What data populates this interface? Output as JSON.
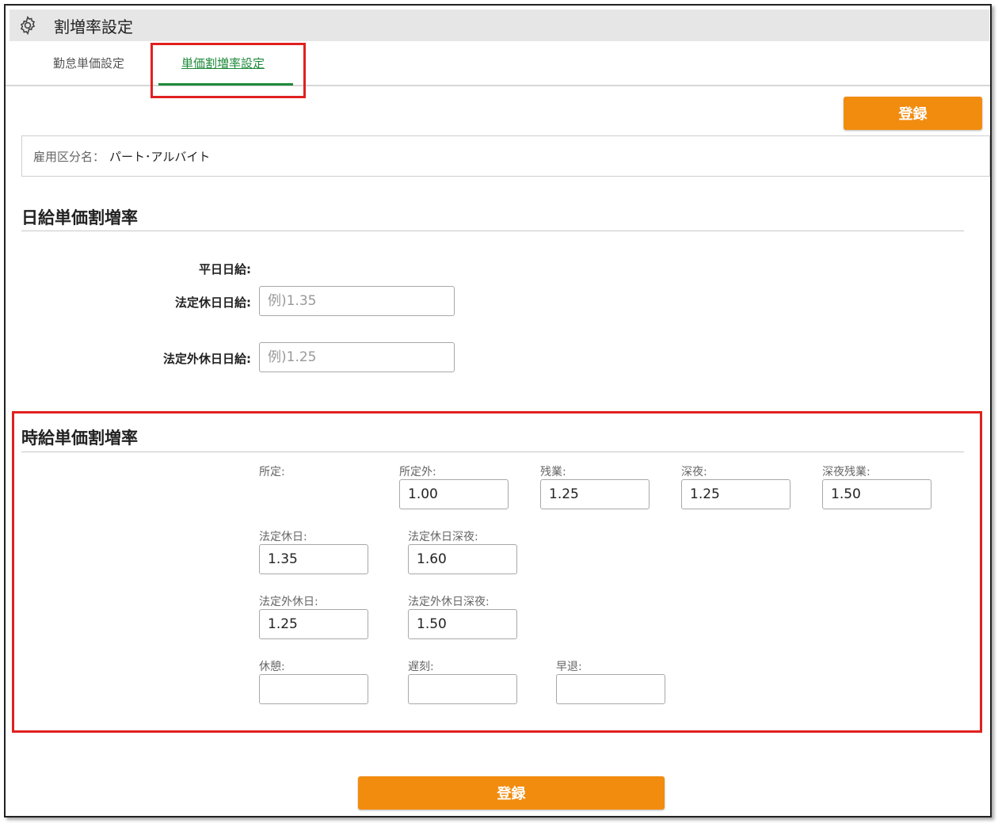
{
  "page_title": "割増率設定",
  "tabs": [
    {
      "label": "勤怠単価設定",
      "active": false
    },
    {
      "label": "単価割増率設定",
      "active": true
    }
  ],
  "register_label": "登録",
  "employment": {
    "label": "雇用区分名：",
    "value": "パート･アルバイト"
  },
  "daily": {
    "heading": "日給単価割増率",
    "weekday_label": "平日日給:",
    "legal_holiday_label": "法定休日日給:",
    "legal_holiday_placeholder": "例)1.35",
    "nonlegal_holiday_label": "法定外休日日給:",
    "nonlegal_holiday_placeholder": "例)1.25"
  },
  "hourly": {
    "heading": "時給単価割増率",
    "fields": {
      "scheduled": {
        "label": "所定:",
        "value": ""
      },
      "out_of_schedule": {
        "label": "所定外:",
        "value": "1.00"
      },
      "overtime": {
        "label": "残業:",
        "value": "1.25"
      },
      "late_night": {
        "label": "深夜:",
        "value": "1.25"
      },
      "late_night_overtime": {
        "label": "深夜残業:",
        "value": "1.50"
      },
      "legal_holiday": {
        "label": "法定休日:",
        "value": "1.35"
      },
      "legal_holiday_night": {
        "label": "法定休日深夜:",
        "value": "1.60"
      },
      "nonlegal_holiday": {
        "label": "法定外休日:",
        "value": "1.25"
      },
      "nonlegal_holiday_night": {
        "label": "法定外休日深夜:",
        "value": "1.50"
      },
      "break": {
        "label": "休憩:",
        "value": ""
      },
      "late": {
        "label": "遅刻:",
        "value": ""
      },
      "early_leave": {
        "label": "早退:",
        "value": ""
      }
    }
  },
  "colors": {
    "accent": "#f28c0f",
    "active_tab": "#1e8a3a",
    "highlight": "#e02020"
  }
}
